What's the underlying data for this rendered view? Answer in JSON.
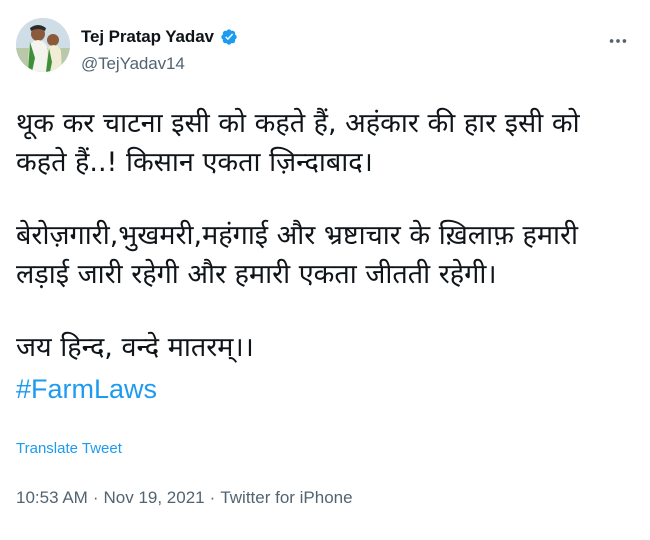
{
  "author": {
    "display_name": "Tej Pratap Yadav",
    "handle": "@TejYadav14",
    "verified": true,
    "avatar_icon": "profile-photo"
  },
  "tweet": {
    "paragraphs": [
      "थूक कर चाटना इसी को कहते हैं, अहंकार की हार इसी को कहते हैं..! किसान एकता ज़िन्दाबाद।",
      "बेरोज़गारी,भुखमरी,महंगाई और भ्रष्टाचार के ख़िलाफ़ हमारी लड़ाई जारी रहेगी और हमारी एकता जीतती रहेगी।",
      "जय हिन्द, वन्दे मातरम्।।"
    ],
    "hashtag": "#FarmLaws"
  },
  "actions": {
    "translate_label": "Translate Tweet",
    "more_icon": "more-icon"
  },
  "meta": {
    "time": "10:53 AM",
    "date": "Nov 19, 2021",
    "source": "Twitter for iPhone",
    "separator": "·"
  },
  "colors": {
    "accent": "#1d9bf0",
    "text": "#0f1419",
    "secondary": "#536471"
  }
}
